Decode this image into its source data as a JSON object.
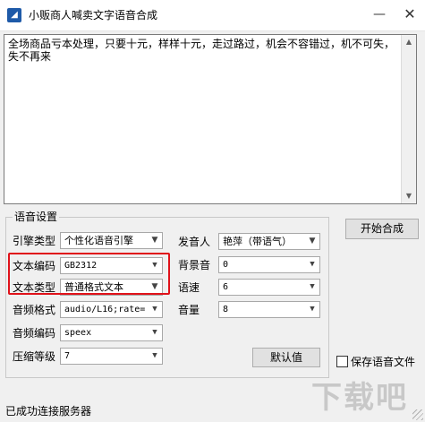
{
  "window": {
    "title": "小贩商人喊卖文字语音合成",
    "minimize_glyph": "—",
    "close_glyph": "✕",
    "app_icon_text": "◢"
  },
  "editor": {
    "text": "全场商品亏本处理，只要十元，样样十元，走过路过，机会不容错过，机不可失，失不再来"
  },
  "speech_settings": {
    "group_title": "语音设置",
    "engine_type": {
      "label": "引擎类型",
      "value": "个性化语音引擎"
    },
    "text_encoding": {
      "label": "文本编码",
      "value": "GB2312"
    },
    "text_type": {
      "label": "文本类型",
      "value": "普通格式文本"
    },
    "audio_format": {
      "label": "音频格式",
      "value": "audio/L16;rate="
    },
    "audio_encoding": {
      "label": "音频编码",
      "value": "speex"
    },
    "compression_level": {
      "label": "压缩等级",
      "value": "7"
    },
    "speaker": {
      "label": "发音人",
      "value": "艳萍（带语气）"
    },
    "background_sound": {
      "label": "背景音",
      "value": "0"
    },
    "speed": {
      "label": "语速",
      "value": "6"
    },
    "volume": {
      "label": "音量",
      "value": "8"
    },
    "default_button": "默认值"
  },
  "actions": {
    "start_button": "开始合成",
    "save_audio_label": "保存语音文件"
  },
  "status_bar": {
    "text": "已成功连接服务器"
  },
  "watermark": {
    "text": "下载吧"
  },
  "colors": {
    "highlight": "#e0121a",
    "window_bg": "#f0f0f0"
  },
  "icons": {
    "dropdown": "chevron-down-icon",
    "app": "app-icon"
  }
}
